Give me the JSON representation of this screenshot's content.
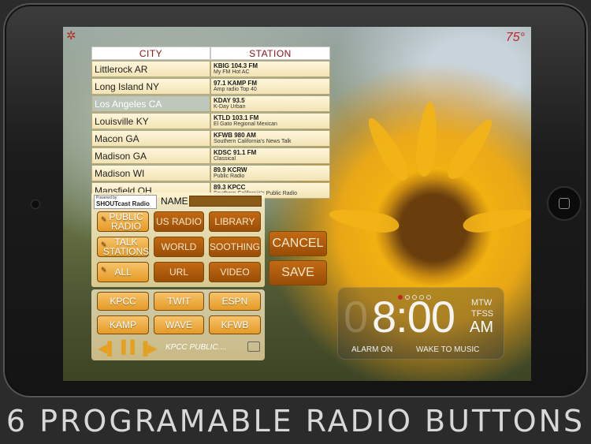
{
  "status": {
    "temperature": "75°"
  },
  "table": {
    "headers": {
      "city": "CITY",
      "station": "STATION"
    },
    "rows": [
      {
        "city": "Littlerock AR",
        "station": "KBIG 104.3 FM",
        "desc": "My FM Hot AC"
      },
      {
        "city": "Long Island NY",
        "station": "97.1 KAMP FM",
        "desc": "Amp radio Top 40"
      },
      {
        "city": "Los Angeles CA",
        "station": "KDAY 93.5",
        "desc": "K-Day Urban"
      },
      {
        "city": "Louisville KY",
        "station": "KTLD 103.1 FM",
        "desc": "El Gato Regional Mexican"
      },
      {
        "city": "Macon GA",
        "station": "KFWB 980 AM",
        "desc": "Southern California's News Talk"
      },
      {
        "city": "Madison GA",
        "station": "KDSC 91.1 FM",
        "desc": "Classical"
      },
      {
        "city": "Madison WI",
        "station": "89.9 KCRW",
        "desc": "Public Radio"
      },
      {
        "city": "Mansfield OH",
        "station": "89.3 KPCC",
        "desc": "Southern California's Public Radio"
      }
    ]
  },
  "panel": {
    "powered_by": "Powered by",
    "shoutcast": "SHOUTcast Radio",
    "name_label": "NAME",
    "buttons": {
      "public_radio": "PUBLIC RADIO",
      "us_radio": "US RADIO",
      "library": "LIBRARY",
      "talk_stations": "TALK STATIONS",
      "world": "WORLD",
      "soothing": "SOOTHING",
      "all": "ALL",
      "url": "URL",
      "video": "VIDEO",
      "cancel": "CANCEL",
      "save": "SAVE"
    }
  },
  "presets": [
    "KPCC",
    "TWIT",
    "ESPN",
    "KAMP",
    "WAVE",
    "KFWB"
  ],
  "player": {
    "now_playing": "KPCC PUBLIC...."
  },
  "clock": {
    "ghost_digit": "0",
    "time": "8:00",
    "days_line1": "MTW",
    "days_line2": "TFSS",
    "ampm": "AM",
    "alarm_status": "ALARM ON",
    "wake_mode": "WAKE TO MUSIC"
  },
  "caption": "6 PROGRAMABLE RADIO BUTTONS",
  "colors": {
    "accent": "#e59a26",
    "dark_button": "#9a4d06",
    "temperature": "#c0262a"
  }
}
